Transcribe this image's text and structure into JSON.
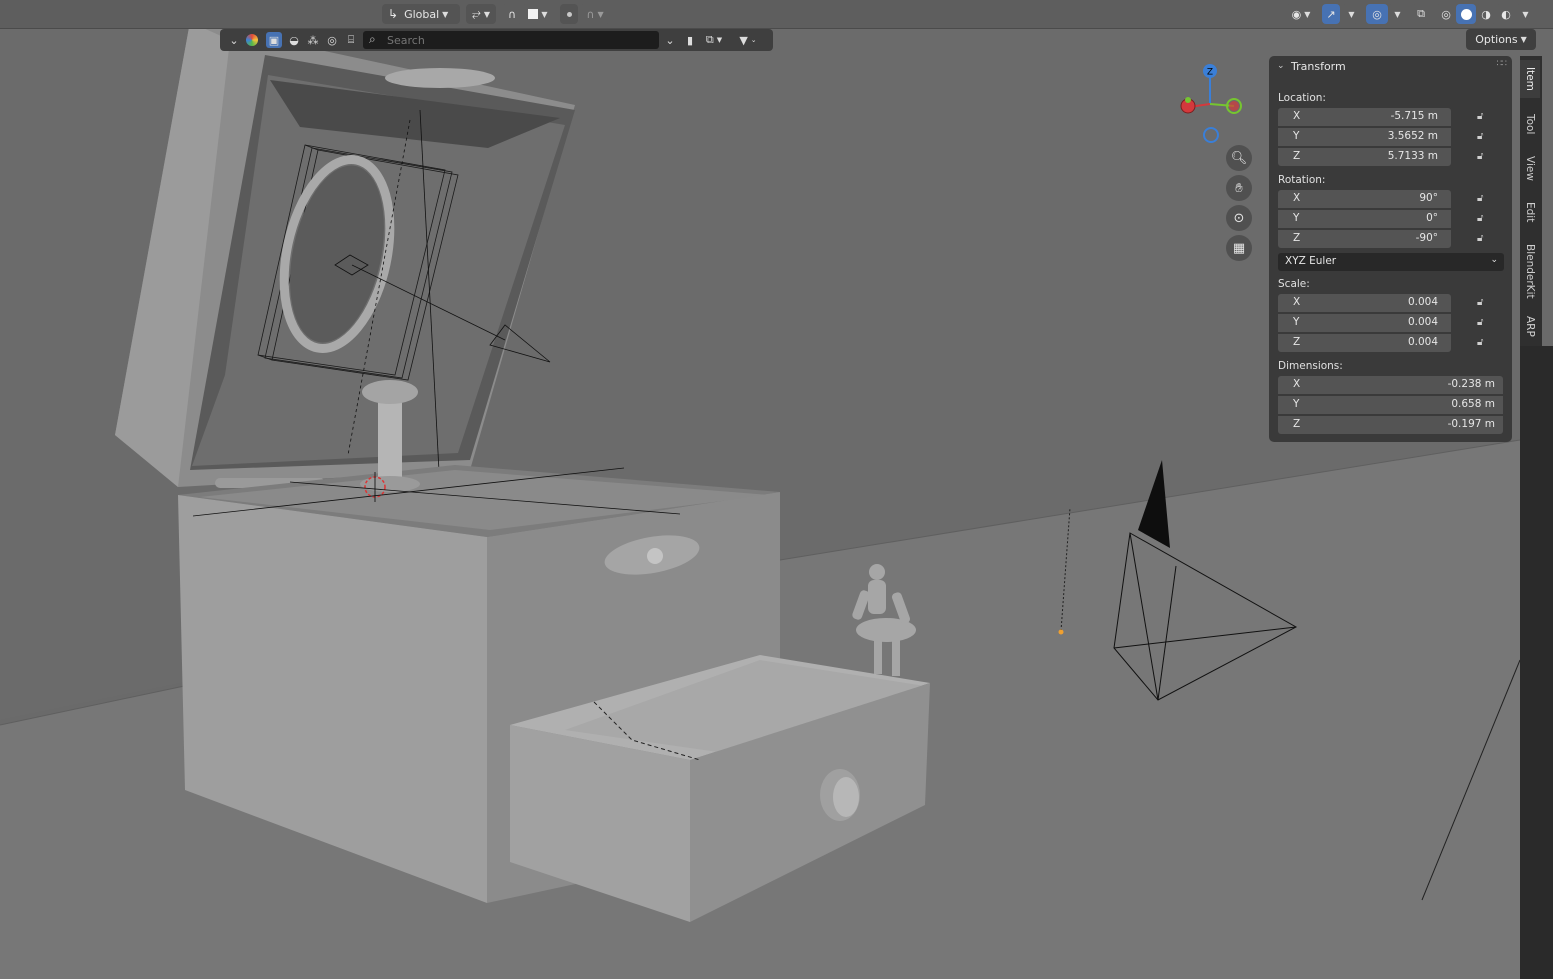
{
  "header": {
    "transform_orientation": "Global",
    "options_label": "Options"
  },
  "toolbar": {
    "search_placeholder": "Search"
  },
  "gizmo": {
    "z_label": "Z"
  },
  "transform_panel": {
    "title": "Transform",
    "location_label": "Location:",
    "location": [
      {
        "axis": "X",
        "value": "-5.715 m"
      },
      {
        "axis": "Y",
        "value": "3.5652 m"
      },
      {
        "axis": "Z",
        "value": "5.7133 m"
      }
    ],
    "rotation_label": "Rotation:",
    "rotation": [
      {
        "axis": "X",
        "value": "90°"
      },
      {
        "axis": "Y",
        "value": "0°"
      },
      {
        "axis": "Z",
        "value": "-90°"
      }
    ],
    "rotation_mode": "XYZ Euler",
    "scale_label": "Scale:",
    "scale": [
      {
        "axis": "X",
        "value": "0.004"
      },
      {
        "axis": "Y",
        "value": "0.004"
      },
      {
        "axis": "Z",
        "value": "0.004"
      }
    ],
    "dimensions_label": "Dimensions:",
    "dimensions": [
      {
        "axis": "X",
        "value": "-0.238 m"
      },
      {
        "axis": "Y",
        "value": "0.658 m"
      },
      {
        "axis": "Z",
        "value": "-0.197 m"
      }
    ]
  },
  "sidebar_tabs": [
    "Item",
    "Tool",
    "View",
    "Edit",
    "BlenderKit",
    "ARP"
  ],
  "colors": {
    "axis_x": "#d4393c",
    "axis_y": "#76c530",
    "axis_z": "#3a7fd8",
    "active_blue": "#4772b3"
  }
}
